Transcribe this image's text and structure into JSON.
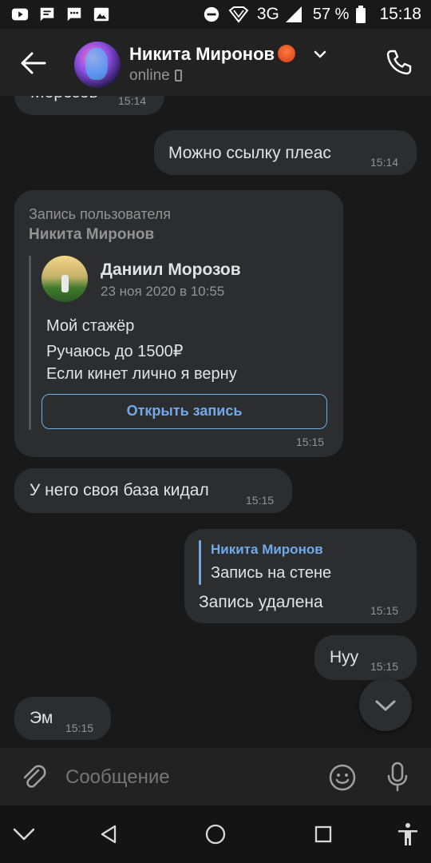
{
  "status_bar": {
    "network": "3G",
    "battery": "57 %",
    "time": "15:18",
    "left_icons": [
      "youtube-icon",
      "message-icon",
      "chat-icon",
      "image-icon"
    ],
    "right_icons": [
      "dnd-icon",
      "signal-icon",
      "battery-icon"
    ]
  },
  "header": {
    "name": "Никита Миронов",
    "status": "online",
    "icons": [
      "back-arrow-icon",
      "avatar",
      "emoji-badge",
      "chevron-down-icon",
      "phone-small-icon",
      "call-icon"
    ]
  },
  "messages": [
    {
      "id": "m0",
      "side": "in",
      "text": "Морозов",
      "time": "15:14"
    },
    {
      "id": "m1",
      "side": "out",
      "text": "Можно ссылку плеас",
      "time": "15:14"
    },
    {
      "id": "m2",
      "side": "in",
      "type": "wall_post",
      "title": "Запись пользователя",
      "subtitle": "Никита Миронов",
      "post": {
        "author": "Даниил Морозов",
        "date": "23 ноя 2020 в 10:55",
        "lines": [
          "Мой стажёр",
          "Ручаюсь до 1500₽",
          "Если кинет лично я верну"
        ],
        "button": "Открыть запись"
      },
      "time": "15:15"
    },
    {
      "id": "m3",
      "side": "in",
      "text": "У него своя база кидал",
      "time": "15:15"
    },
    {
      "id": "m4",
      "side": "out",
      "reply_to": "Никита Миронов",
      "reply_text": "Запись на стене",
      "text": "Запись удалена",
      "time": "15:15"
    },
    {
      "id": "m5",
      "side": "out",
      "text": "Нуу",
      "time": "15:15"
    },
    {
      "id": "m6",
      "side": "in",
      "text": "Эм",
      "time": "15:15"
    }
  ],
  "composer": {
    "placeholder": "Сообщение",
    "icons": [
      "attach-icon",
      "emoji-icon",
      "microphone-icon"
    ]
  },
  "nav_bar": {
    "icons": [
      "collapse-chevron-icon",
      "back-triangle-icon",
      "home-circle-icon",
      "recents-square-icon",
      "accessibility-icon"
    ]
  },
  "fab": {
    "icon": "scroll-down-icon"
  },
  "colors": {
    "background": "#191919",
    "bubble": "#2c2d2e",
    "accent": "#71aaeb",
    "text": "#e1e3e6",
    "secondary": "#939393"
  }
}
